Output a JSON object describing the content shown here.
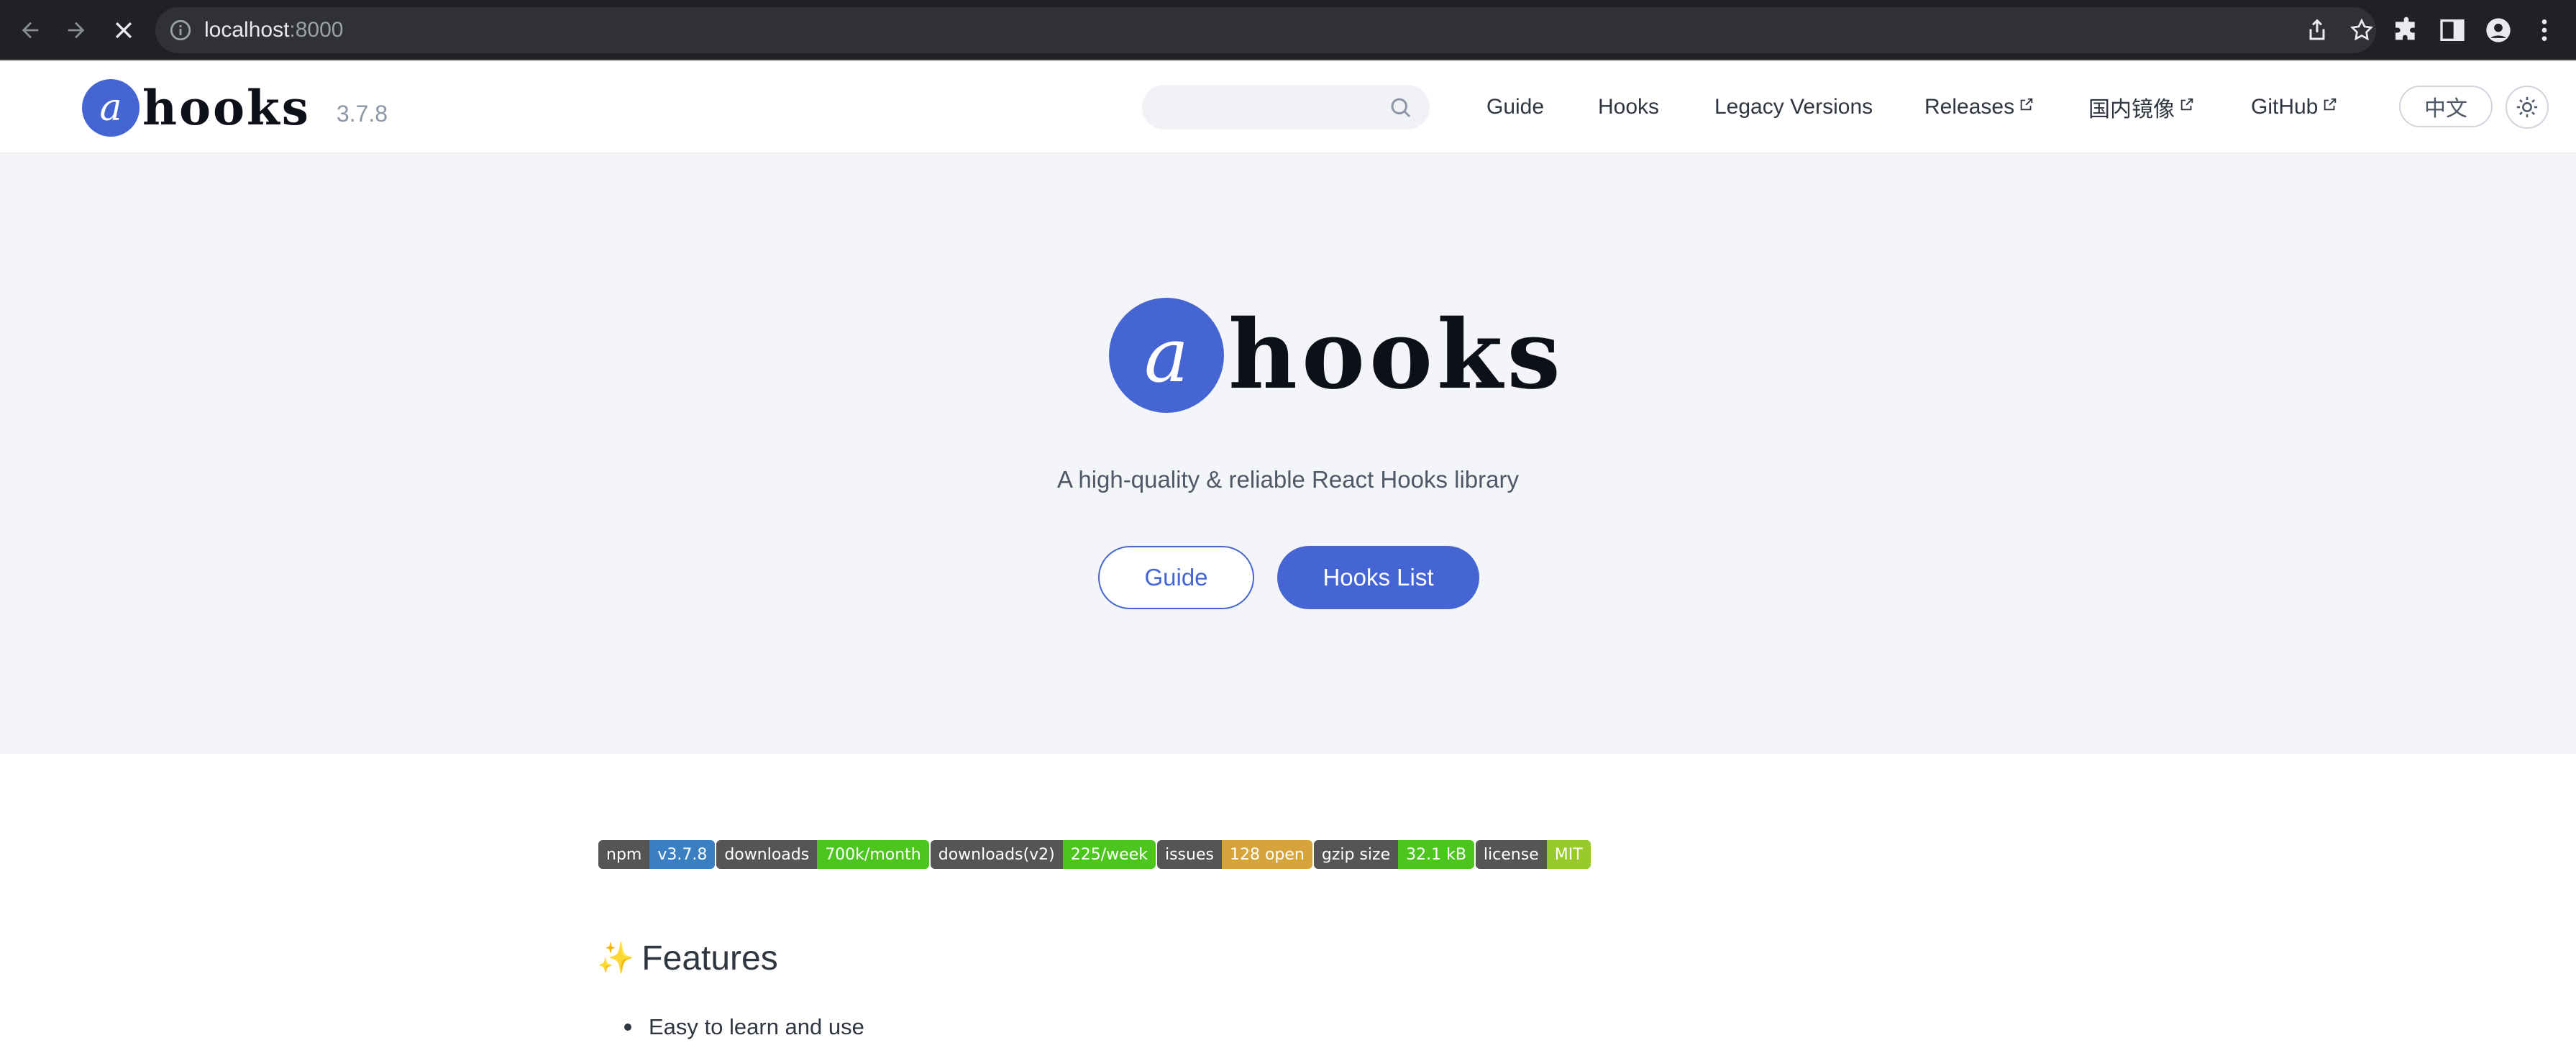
{
  "browser": {
    "url_host": "localhost",
    "url_port": ":8000"
  },
  "header": {
    "logo_letter": "a",
    "logo_word": "hooks",
    "version": "3.7.8",
    "search_placeholder": "",
    "nav": [
      {
        "label": "Guide",
        "external": false
      },
      {
        "label": "Hooks",
        "external": false
      },
      {
        "label": "Legacy Versions",
        "external": false
      },
      {
        "label": "Releases",
        "external": true
      },
      {
        "label": "国内镜像",
        "external": true
      },
      {
        "label": "GitHub",
        "external": true
      }
    ],
    "lang_button": "中文"
  },
  "hero": {
    "logo_letter": "a",
    "logo_word": "hooks",
    "tagline": "A high-quality & reliable React Hooks library",
    "guide_button": "Guide",
    "hooks_list_button": "Hooks List"
  },
  "badges": [
    {
      "label": "npm",
      "value": "v3.7.8",
      "color": "#3a7fc1"
    },
    {
      "label": "downloads",
      "value": "700k/month",
      "color": "#4cc61e"
    },
    {
      "label": "downloads(v2)",
      "value": "225/week",
      "color": "#4cc61e"
    },
    {
      "label": "issues",
      "value": "128 open",
      "color": "#d6a43a"
    },
    {
      "label": "gzip size",
      "value": "32.1 kB",
      "color": "#4cc61e"
    },
    {
      "label": "license",
      "value": "MIT",
      "color": "#97ca2a"
    }
  ],
  "features": {
    "icon": "sparkles-icon",
    "heading": "Features",
    "items": [
      "Easy to learn and use"
    ]
  },
  "colors": {
    "brand": "#4565d5",
    "hero_bg": "#f4f5f8"
  }
}
